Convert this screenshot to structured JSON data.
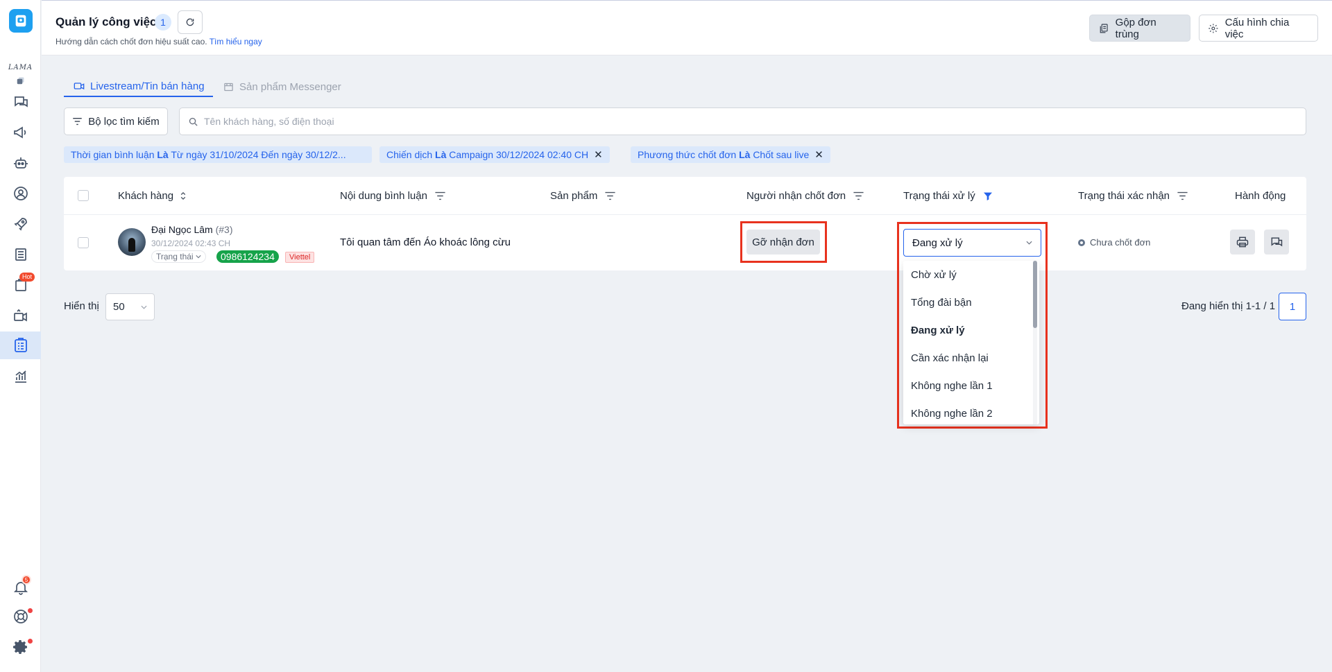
{
  "header": {
    "title": "Quản lý công việc",
    "count": "1",
    "subtitle_text": "Hướng dẫn cách chốt đơn hiệu suất cao.",
    "subtitle_link": "Tìm hiểu ngay",
    "merge_label": "Gộp đơn trùng",
    "config_label": "Cấu hình chia việc"
  },
  "sidebar": {
    "logo_text": "LAMA",
    "hot_badge": "Hot",
    "notification_count": "5"
  },
  "tabs": [
    {
      "label": "Livestream/Tin bán hàng",
      "active": true
    },
    {
      "label": "Sản phẩm Messenger",
      "active": false
    }
  ],
  "filter": {
    "button_label": "Bộ lọc tìm kiếm",
    "search_placeholder": "Tên khách hàng, số điện thoại"
  },
  "chips": [
    {
      "field": "Thời gian bình luận",
      "op": "Là",
      "value": "Từ ngày 31/10/2024 Đến ngày 30/12/2..."
    },
    {
      "field": "Chiến dịch",
      "op": "Là",
      "value": "Campaign 30/12/2024 02:40 CH"
    },
    {
      "field": "Phương thức chốt đơn",
      "op": "Là",
      "value": "Chốt sau live"
    }
  ],
  "table": {
    "columns": [
      "Khách hàng",
      "Nội dung bình luận",
      "Sản phẩm",
      "Người nhận chốt đơn",
      "Trạng thái xử lý",
      "Trạng thái xác nhận",
      "Hành động"
    ],
    "rows": [
      {
        "customer_name": "Đại Ngọc Lâm",
        "customer_id": "(#3)",
        "time": "30/12/2024 02:43 CH",
        "status_label": "Trạng thái",
        "phone": "0986124234",
        "carrier": "Viettel",
        "comment": "Tôi quan tâm đến Áo khoác lông cừu",
        "unassign_label": "Gỡ nhận đơn",
        "process_status": "Đang xử lý",
        "confirm_status": "Chưa chốt đơn"
      }
    ]
  },
  "dropdown": {
    "options": [
      "Chờ xử lý",
      "Tổng đài bận",
      "Đang xử lý",
      "Cần xác nhận lại",
      "Không nghe lần 1",
      "Không nghe lần 2"
    ],
    "selected": "Đang xử lý"
  },
  "pagination": {
    "show_label": "Hiển thị",
    "page_size": "50",
    "info": "Đang hiển thị 1-1 / 1",
    "current_page": "1"
  },
  "colors": {
    "accent": "#2563eb",
    "highlight": "#e8321e",
    "phone_badge": "#16a34a"
  }
}
